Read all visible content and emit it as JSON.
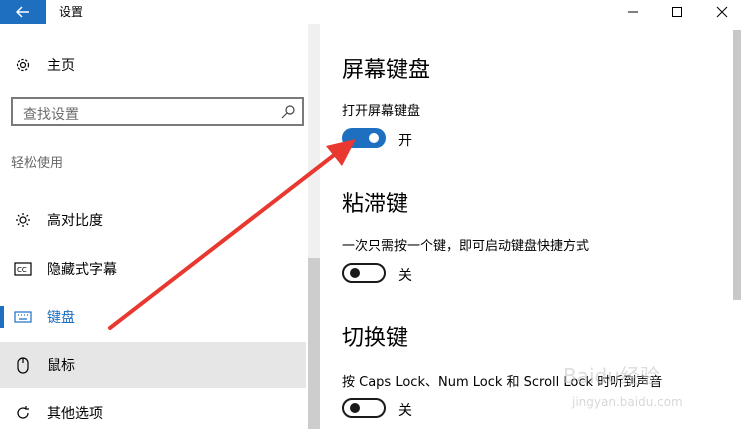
{
  "window": {
    "title": "设置"
  },
  "nav": {
    "home_label": "主页",
    "search_placeholder": "查找设置",
    "group_label": "轻松使用",
    "items": [
      {
        "label": "高对比度",
        "icon": "brightness-icon"
      },
      {
        "label": "隐藏式字幕",
        "icon": "closed-caption-icon"
      },
      {
        "label": "键盘",
        "icon": "keyboard-icon",
        "selected": true
      },
      {
        "label": "鼠标",
        "icon": "mouse-icon",
        "hover": true
      },
      {
        "label": "其他选项",
        "icon": "refresh-icon"
      }
    ]
  },
  "content": {
    "sections": [
      {
        "heading": "屏幕键盘",
        "desc": "打开屏幕键盘",
        "toggle_on": true,
        "state": "开"
      },
      {
        "heading": "粘滞键",
        "desc": "一次只需按一个键，即可启动键盘快捷方式",
        "toggle_on": false,
        "state": "关"
      },
      {
        "heading": "切换键",
        "desc": "按 Caps Lock、Num Lock 和 Scroll Lock 时听到声音",
        "toggle_on": false,
        "state": "关"
      }
    ]
  },
  "colors": {
    "accent": "#1e6fc0",
    "annotation_arrow": "#e8382f"
  },
  "watermark": {
    "text": "Baidu经验",
    "sub": "jingyan.baidu.com"
  }
}
